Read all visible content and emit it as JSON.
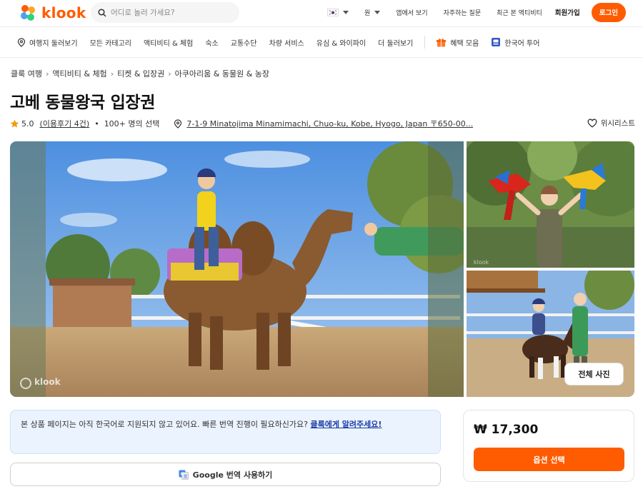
{
  "header": {
    "brand": "klook",
    "search_placeholder": "어디로 놀러 가세요?",
    "currency": "원",
    "app_download": "앱에서 보기",
    "faq": "자주하는 질문",
    "recently_viewed": "최근 본 액티비티",
    "signup": "회원가입",
    "login": "로그인"
  },
  "nav": {
    "items": [
      "여행지 둘러보기",
      "모든 카테고리",
      "액티비티 & 체험",
      "숙소",
      "교통수단",
      "차량 서비스",
      "유심 & 와이파이",
      "더 둘러보기"
    ],
    "promo": "혜택 모음",
    "tour": "한국어 투어"
  },
  "breadcrumb": [
    "클룩 여행",
    "액티비티 & 체험",
    "티켓 & 입장권",
    "아쿠아리움 & 동물원 & 농장"
  ],
  "product": {
    "title": "고베 동물왕국 입장권",
    "rating": "5.0",
    "reviews": "(이용후기 4건)",
    "participants": "100+ 명의 선택",
    "address": "7-1-9 Minatojima Minamimachi, Chuo-ku, Kobe, Hyogo, Japan 〒650-00...",
    "wishlist": "위시리스트"
  },
  "gallery": {
    "watermark": "klook",
    "all_photos": "전체 사진"
  },
  "notice": {
    "text": "본 상품 페이지는 아직 한국어로 지원되지 않고 있어요. 빠른 번역 진행이 필요하신가요?",
    "link": "클룩에게 알려주세요!"
  },
  "google_translate": "Google 번역 사용하기",
  "booking": {
    "price": "₩ 17,300",
    "select": "옵션 선택"
  },
  "colors": {
    "brand": "#ff5b00",
    "notice_bg": "#ebf3fe",
    "link": "#1d3ea8",
    "star": "#f09b0a"
  }
}
